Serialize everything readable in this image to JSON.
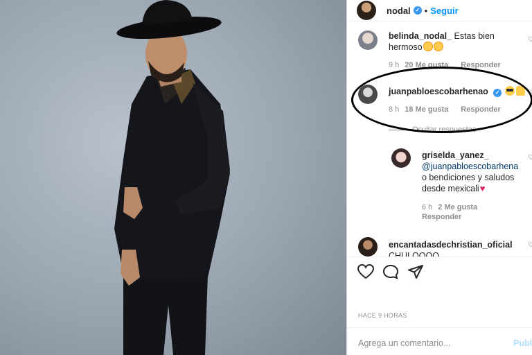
{
  "post": {
    "image_alt": "",
    "author": "nodal",
    "follow_label": "Seguir",
    "separator": "•"
  },
  "comments": [
    {
      "user": "belinda_nodal_",
      "text": "Estas bien hermoso",
      "text_line2": "hermoso",
      "emojis": [
        "star-struck-emoji",
        "star-struck-emoji"
      ],
      "time": "9 h",
      "likes": "20 Me gusta",
      "reply": "Responder"
    },
    {
      "user": "juanpabloescobarhenao",
      "verified": true,
      "emojis": [
        "sunglasses-emoji",
        "thumbs-up-emoji"
      ],
      "time": "8 h",
      "likes": "18 Me gusta",
      "reply": "Responder",
      "hide_replies": "Ocultar respuestas"
    },
    {
      "user": "griselda_yanez_",
      "mention": "@juanpabloescobarhena",
      "text_line2": "o bendiciones y saludos",
      "text_line3": "desde mexicali",
      "emojis": [
        "heart-emoji"
      ],
      "time": "6 h",
      "likes": "2 Me gusta",
      "reply": "Responder"
    },
    {
      "user": "encantadasdechristian_oficial",
      "text": "CHULOOOO"
    }
  ],
  "actions": {
    "like_icon": "heart-icon",
    "comment_icon": "comment-icon",
    "share_icon": "send-icon"
  },
  "timestamp": "HACE 9 HORAS",
  "add_comment": {
    "placeholder": "Agrega un comentario...",
    "publish_label": "Publicar"
  },
  "colors": {
    "accent": "#0095f6",
    "verified": "#3897f0",
    "annotation": "#000000"
  }
}
